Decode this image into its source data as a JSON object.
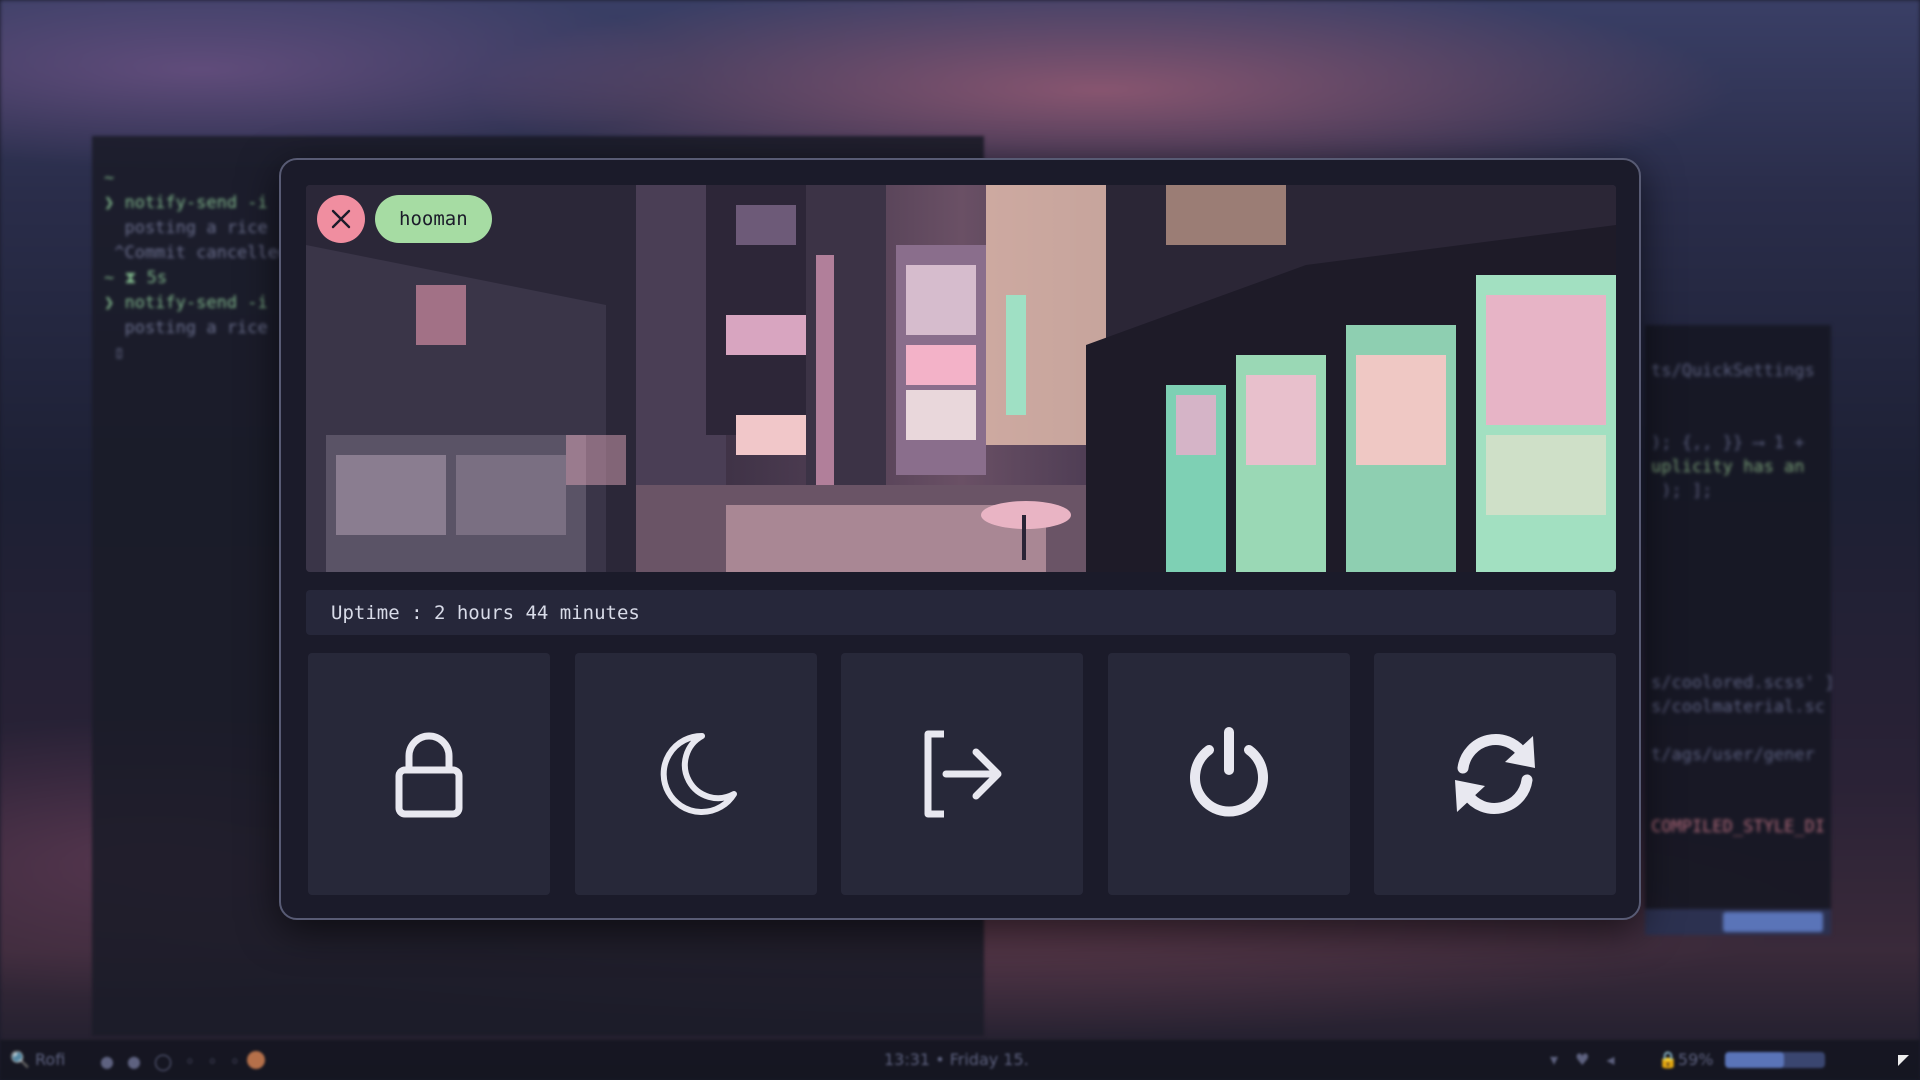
{
  "background": {
    "terminal_lines": [
      "~",
      "❯ notify-send -i",
      "  posting a rice",
      " ^Commit cancelled",
      "",
      "~ ⧗ 5s",
      "❯ notify-send -i",
      "  posting a rice",
      " ▯"
    ],
    "editor_lines": [
      "",
      "ts/QuickSettings",
      "",
      "",
      "); {,, }} ⟶ 1 +",
      "uplicity has an",
      " ); ];",
      "",
      "",
      "",
      "",
      "",
      "",
      "",
      "s/coolored.scss' }",
      "s/coolmaterial.sc",
      "",
      "t/ags/user/gener",
      "",
      "",
      "COMPILED_STYLE_DI"
    ]
  },
  "taskbar": {
    "launcher": "🔍 Rofi",
    "workspaces": "● ● ◯ ◦ ◦ ◦ ◦",
    "clock": "13:31 • Friday 15.",
    "battery": "🔒59%",
    "battery_level": 0.59
  },
  "power_menu": {
    "close_icon": "close-icon",
    "username": "hooman",
    "uptime_text": "Uptime : 2 hours 44 minutes",
    "actions": [
      {
        "name": "lock",
        "icon": "lock-icon"
      },
      {
        "name": "sleep",
        "icon": "moon-icon"
      },
      {
        "name": "logout",
        "icon": "logout-icon"
      },
      {
        "name": "shutdown",
        "icon": "power-icon"
      },
      {
        "name": "reboot",
        "icon": "refresh-icon"
      }
    ],
    "colors": {
      "close_button": "#f08ea0",
      "user_pill": "#a6dca3",
      "panel_bg": "#1b1b2a",
      "button_bg": "#272839",
      "icon": "#e8e8f0"
    }
  }
}
